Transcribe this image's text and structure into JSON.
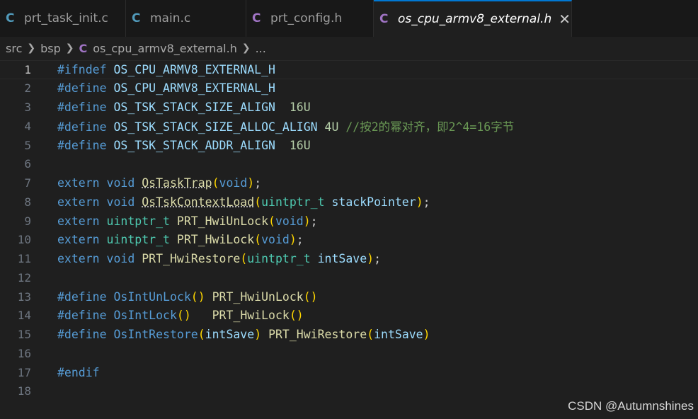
{
  "tabs": [
    {
      "label": "prt_task_init.c",
      "icon": "C",
      "icon_color": "#519aba"
    },
    {
      "label": "main.c",
      "icon": "C",
      "icon_color": "#519aba"
    },
    {
      "label": "prt_config.h",
      "icon": "C",
      "icon_color": "#a074c4"
    },
    {
      "label": "os_cpu_armv8_external.h",
      "icon": "C",
      "icon_color": "#a074c4",
      "active": true,
      "close": "✕"
    }
  ],
  "breadcrumb": {
    "parts": [
      "src",
      "bsp"
    ],
    "file_icon": "C",
    "file": "os_cpu_armv8_external.h",
    "more": "..."
  },
  "code": {
    "current_line": 1,
    "lines": [
      {
        "n": "1",
        "tokens": [
          [
            "mac",
            "#ifndef"
          ],
          [
            "pu",
            " "
          ],
          [
            "pv",
            "OS_CPU_ARMV8_EXTERNAL_H"
          ]
        ]
      },
      {
        "n": "2",
        "tokens": [
          [
            "mac",
            "#define"
          ],
          [
            "pu",
            " "
          ],
          [
            "pv",
            "OS_CPU_ARMV8_EXTERNAL_H"
          ]
        ]
      },
      {
        "n": "3",
        "tokens": [
          [
            "mac",
            "#define"
          ],
          [
            "pu",
            " "
          ],
          [
            "pv",
            "OS_TSK_STACK_SIZE_ALIGN"
          ],
          [
            "pu",
            "  "
          ],
          [
            "num",
            "16U"
          ]
        ]
      },
      {
        "n": "4",
        "tokens": [
          [
            "mac",
            "#define"
          ],
          [
            "pu",
            " "
          ],
          [
            "pv",
            "OS_TSK_STACK_SIZE_ALLOC_ALIGN"
          ],
          [
            "pu",
            " "
          ],
          [
            "num",
            "4U"
          ],
          [
            "pu",
            " "
          ],
          [
            "cm",
            "//按2的幂对齐，即2^4=16字节"
          ]
        ]
      },
      {
        "n": "5",
        "tokens": [
          [
            "mac",
            "#define"
          ],
          [
            "pu",
            " "
          ],
          [
            "pv",
            "OS_TSK_STACK_ADDR_ALIGN"
          ],
          [
            "pu",
            "  "
          ],
          [
            "num",
            "16U"
          ]
        ]
      },
      {
        "n": "6",
        "tokens": []
      },
      {
        "n": "7",
        "tokens": [
          [
            "kw",
            "extern"
          ],
          [
            "pu",
            " "
          ],
          [
            "kw",
            "void"
          ],
          [
            "pu",
            " "
          ],
          [
            "fnsq",
            "OsTaskTrap"
          ],
          [
            "br1",
            "("
          ],
          [
            "kw",
            "void"
          ],
          [
            "br1",
            ")"
          ],
          [
            "pu",
            ";"
          ]
        ]
      },
      {
        "n": "8",
        "tokens": [
          [
            "kw",
            "extern"
          ],
          [
            "pu",
            " "
          ],
          [
            "kw",
            "void"
          ],
          [
            "pu",
            " "
          ],
          [
            "fnsq",
            "OsTskContextLoad"
          ],
          [
            "br1",
            "("
          ],
          [
            "ty",
            "uintptr_t"
          ],
          [
            "pu",
            " "
          ],
          [
            "pm",
            "stackPointer"
          ],
          [
            "br1",
            ")"
          ],
          [
            "pu",
            ";"
          ]
        ]
      },
      {
        "n": "9",
        "tokens": [
          [
            "kw",
            "extern"
          ],
          [
            "pu",
            " "
          ],
          [
            "ty",
            "uintptr_t"
          ],
          [
            "pu",
            " "
          ],
          [
            "fn",
            "PRT_HwiUnLock"
          ],
          [
            "br1",
            "("
          ],
          [
            "kw",
            "void"
          ],
          [
            "br1",
            ")"
          ],
          [
            "pu",
            ";"
          ]
        ]
      },
      {
        "n": "10",
        "tokens": [
          [
            "kw",
            "extern"
          ],
          [
            "pu",
            " "
          ],
          [
            "ty",
            "uintptr_t"
          ],
          [
            "pu",
            " "
          ],
          [
            "fn",
            "PRT_HwiLock"
          ],
          [
            "br1",
            "("
          ],
          [
            "kw",
            "void"
          ],
          [
            "br1",
            ")"
          ],
          [
            "pu",
            ";"
          ]
        ]
      },
      {
        "n": "11",
        "tokens": [
          [
            "kw",
            "extern"
          ],
          [
            "pu",
            " "
          ],
          [
            "kw",
            "void"
          ],
          [
            "pu",
            " "
          ],
          [
            "fn",
            "PRT_HwiRestore"
          ],
          [
            "br1",
            "("
          ],
          [
            "ty",
            "uintptr_t"
          ],
          [
            "pu",
            " "
          ],
          [
            "pm",
            "intSave"
          ],
          [
            "br1",
            ")"
          ],
          [
            "pu",
            ";"
          ]
        ]
      },
      {
        "n": "12",
        "tokens": []
      },
      {
        "n": "13",
        "tokens": [
          [
            "mac",
            "#define"
          ],
          [
            "pu",
            " "
          ],
          [
            "mac",
            "OsIntUnLock"
          ],
          [
            "br1",
            "()"
          ],
          [
            "pu",
            " "
          ],
          [
            "fn",
            "PRT_HwiUnLock"
          ],
          [
            "br1",
            "()"
          ]
        ]
      },
      {
        "n": "14",
        "tokens": [
          [
            "mac",
            "#define"
          ],
          [
            "pu",
            " "
          ],
          [
            "mac",
            "OsIntLock"
          ],
          [
            "br1",
            "()"
          ],
          [
            "pu",
            "   "
          ],
          [
            "fn",
            "PRT_HwiLock"
          ],
          [
            "br1",
            "()"
          ]
        ]
      },
      {
        "n": "15",
        "tokens": [
          [
            "mac",
            "#define"
          ],
          [
            "pu",
            " "
          ],
          [
            "mac",
            "OsIntRestore"
          ],
          [
            "br1",
            "("
          ],
          [
            "pm",
            "intSave"
          ],
          [
            "br1",
            ")"
          ],
          [
            "pu",
            " "
          ],
          [
            "fn",
            "PRT_HwiRestore"
          ],
          [
            "br1",
            "("
          ],
          [
            "pm",
            "intSave"
          ],
          [
            "br1",
            ")"
          ]
        ]
      },
      {
        "n": "16",
        "tokens": []
      },
      {
        "n": "17",
        "tokens": [
          [
            "mac",
            "#endif"
          ]
        ]
      },
      {
        "n": "18",
        "tokens": []
      }
    ]
  },
  "watermark": "CSDN @Autumnshines"
}
